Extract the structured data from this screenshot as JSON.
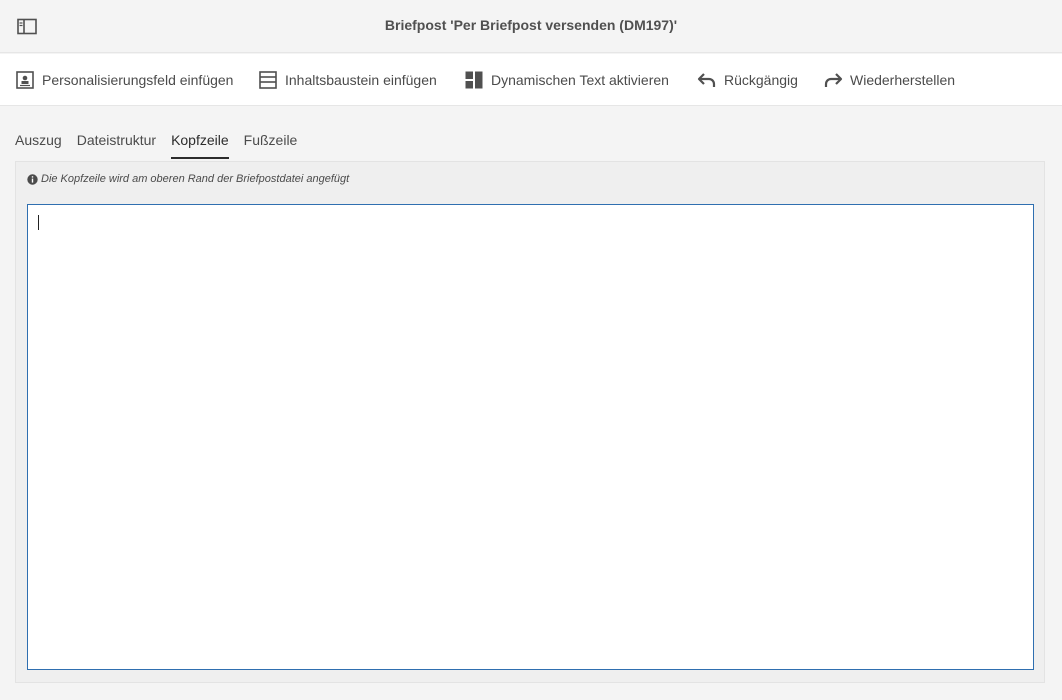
{
  "window": {
    "title": "Briefpost 'Per Briefpost versenden (DM197)'",
    "panel_toggle_icon": "sidebar-panel-icon"
  },
  "toolbar": {
    "items": [
      {
        "label": "Personalisierungsfeld einfügen",
        "icon": "personalization-field-icon"
      },
      {
        "label": "Inhaltsbaustein einfügen",
        "icon": "content-block-icon"
      },
      {
        "label": "Dynamischen Text aktivieren",
        "icon": "dynamic-text-icon"
      },
      {
        "label": "Rückgängig",
        "icon": "undo-icon"
      },
      {
        "label": "Wiederherstellen",
        "icon": "redo-icon"
      }
    ]
  },
  "tabs": [
    {
      "label": "Auszug",
      "active": false
    },
    {
      "label": "Dateistruktur",
      "active": false
    },
    {
      "label": "Kopfzeile",
      "active": true
    },
    {
      "label": "Fußzeile",
      "active": false
    }
  ],
  "info": {
    "icon": "info-icon",
    "text": "Die Kopfzeile wird am oberen Rand der Briefpostdatei angefügt"
  },
  "editor": {
    "value": ""
  },
  "colors": {
    "editor_border": "#2f6fb0",
    "active_tab": "#2c2c2c"
  }
}
